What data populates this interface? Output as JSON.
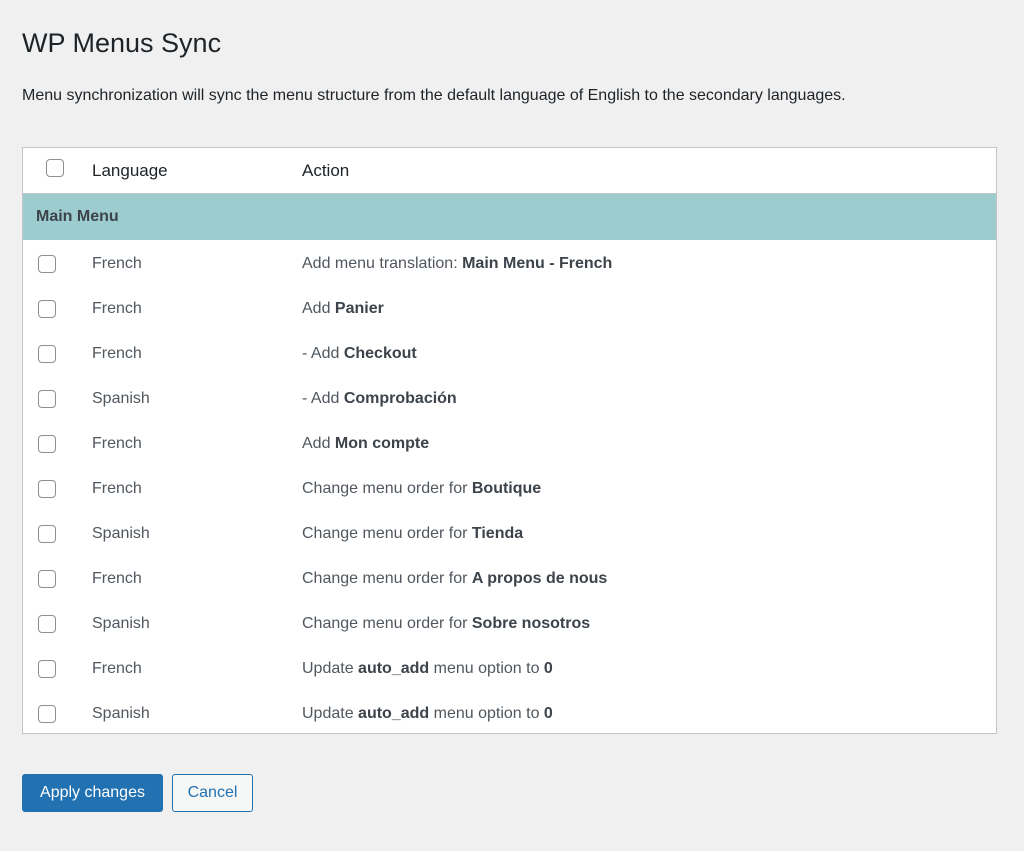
{
  "page": {
    "title": "WP Menus Sync",
    "description": "Menu synchronization will sync the menu structure from the default language of English to the secondary languages."
  },
  "table": {
    "headers": {
      "language": "Language",
      "action": "Action"
    },
    "group": "Main Menu",
    "rows": [
      {
        "language": "French",
        "pre": "Add menu translation: ",
        "bold": "Main Menu - French",
        "mid": "",
        "bold2": ""
      },
      {
        "language": "French",
        "pre": "Add ",
        "bold": "Panier",
        "mid": "",
        "bold2": ""
      },
      {
        "language": "French",
        "pre": "- Add ",
        "bold": "Checkout",
        "mid": "",
        "bold2": ""
      },
      {
        "language": "Spanish",
        "pre": "- Add ",
        "bold": "Comprobación",
        "mid": "",
        "bold2": ""
      },
      {
        "language": "French",
        "pre": "Add ",
        "bold": "Mon compte",
        "mid": "",
        "bold2": ""
      },
      {
        "language": "French",
        "pre": "Change menu order for ",
        "bold": "Boutique",
        "mid": "",
        "bold2": ""
      },
      {
        "language": "Spanish",
        "pre": "Change menu order for ",
        "bold": "Tienda",
        "mid": "",
        "bold2": ""
      },
      {
        "language": "French",
        "pre": "Change menu order for ",
        "bold": "A propos de nous",
        "mid": "",
        "bold2": ""
      },
      {
        "language": "Spanish",
        "pre": "Change menu order for ",
        "bold": "Sobre nosotros",
        "mid": "",
        "bold2": ""
      },
      {
        "language": "French",
        "pre": "Update ",
        "bold": "auto_add",
        "mid": " menu option to ",
        "bold2": "0"
      },
      {
        "language": "Spanish",
        "pre": "Update ",
        "bold": "auto_add",
        "mid": " menu option to ",
        "bold2": "0"
      }
    ]
  },
  "buttons": {
    "apply": "Apply changes",
    "cancel": "Cancel"
  }
}
